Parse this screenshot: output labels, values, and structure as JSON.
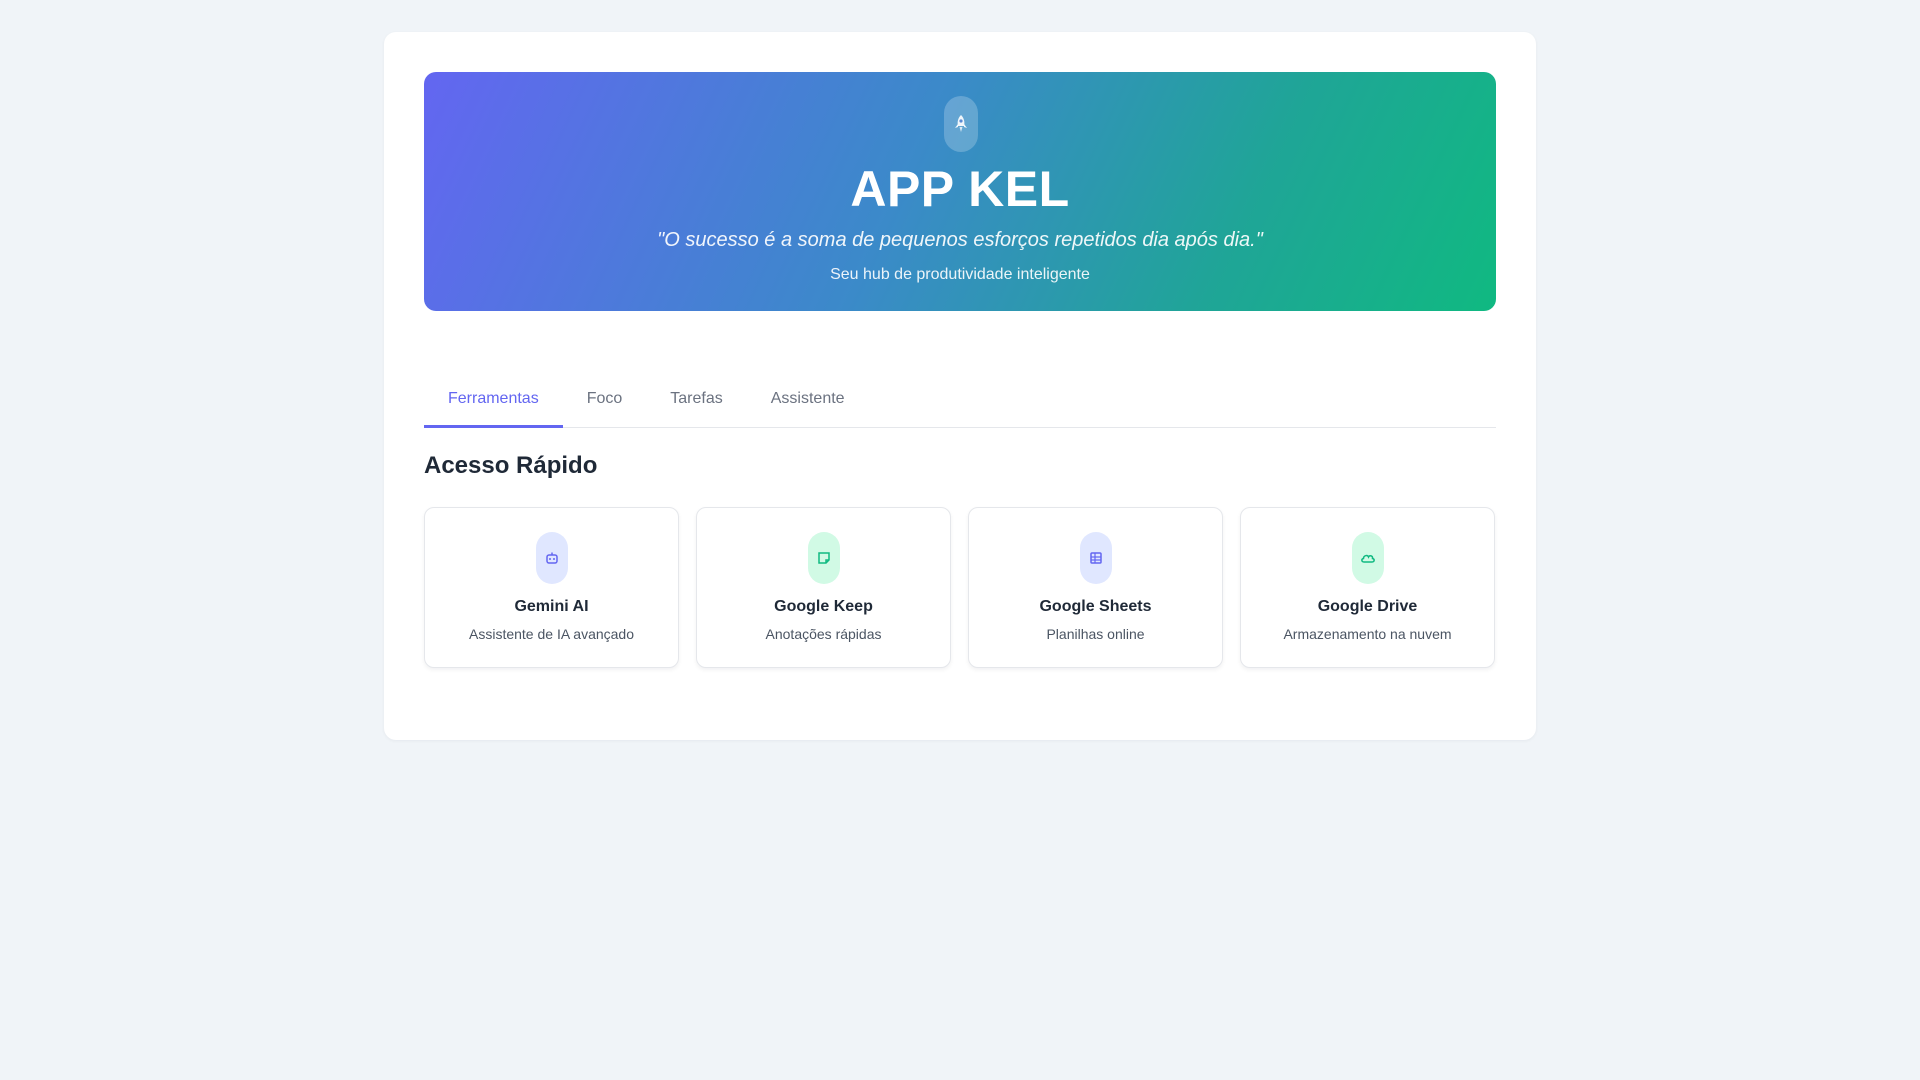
{
  "header": {
    "icon": "rocket-icon",
    "title": "APP KEL",
    "quote": "\"O sucesso é a soma de pequenos esforços repetidos dia após dia.\"",
    "subtitle": "Seu hub de produtividade inteligente",
    "gradient_colors": [
      "#6366f1",
      "#10b981"
    ]
  },
  "tabs": [
    {
      "label": "Ferramentas",
      "active": true
    },
    {
      "label": "Foco",
      "active": false
    },
    {
      "label": "Tarefas",
      "active": false
    },
    {
      "label": "Assistente",
      "active": false
    }
  ],
  "quick_access": {
    "title": "Acesso Rápido",
    "tools": [
      {
        "name": "Gemini AI",
        "description": "Assistente de IA avançado",
        "icon": "robot-icon",
        "accent": "#6366f1"
      },
      {
        "name": "Google Keep",
        "description": "Anotações rápidas",
        "icon": "sticky-note-icon",
        "accent": "#10b981"
      },
      {
        "name": "Google Sheets",
        "description": "Planilhas online",
        "icon": "table-icon",
        "accent": "#6366f1"
      },
      {
        "name": "Google Drive",
        "description": "Armazenamento na nuvem",
        "icon": "cloud-icon",
        "accent": "#10b981"
      }
    ]
  },
  "colors": {
    "accent": "#6366f1",
    "accent_secondary": "#10b981",
    "background": "#f0f4f8"
  }
}
